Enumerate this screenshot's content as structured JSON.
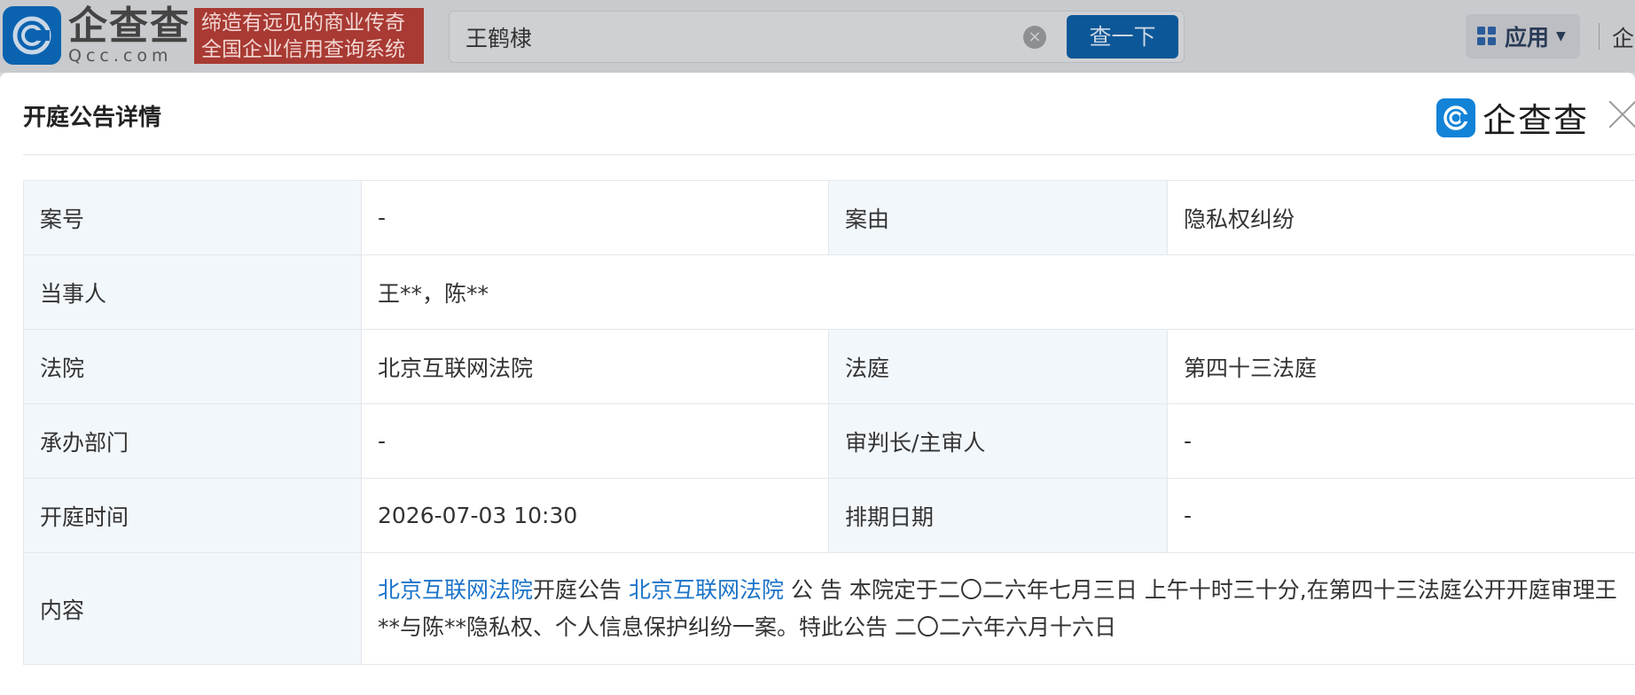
{
  "topbar": {
    "logo_cn": "企查查",
    "logo_en": "Qcc.com",
    "slogan_line1": "缔造有远见的商业传奇",
    "slogan_line2": "全国企业信用查询系统",
    "search_value": "王鹤棣",
    "search_button": "查一下",
    "apps_label": "应用",
    "right_text": "企"
  },
  "modal": {
    "title": "开庭公告详情",
    "brand": "企查查"
  },
  "detail": {
    "case_no_label": "案号",
    "case_no_value": "-",
    "cause_label": "案由",
    "cause_value": "隐私权纠纷",
    "parties_label": "当事人",
    "parties_value": "王**，陈**",
    "court_label": "法院",
    "court_value": "北京互联网法院",
    "tribunal_label": "法庭",
    "tribunal_value": "第四十三法庭",
    "dept_label": "承办部门",
    "dept_value": "-",
    "judge_label": "审判长/主审人",
    "judge_value": "-",
    "hearing_time_label": "开庭时间",
    "hearing_time_value": "2026-07-03 10:30",
    "schedule_date_label": "排期日期",
    "schedule_date_value": "-",
    "content_label": "内容",
    "content_link1": "北京互联网法院",
    "content_text1": "开庭公告 ",
    "content_link2": "北京互联网法院",
    "content_text2": " 公 告 本院定于二〇二六年七月三日 上午十时三十分,在第四十三法庭公开开庭审理王**与陈**隐私权、个人信息保护纠纷一案。特此公告 二〇二六年六月十六日"
  },
  "colors": {
    "brand_blue": "#1383d8",
    "link_blue": "#1a73c9",
    "label_bg": "#f2f7fc",
    "slogan_red": "#a83a33"
  }
}
